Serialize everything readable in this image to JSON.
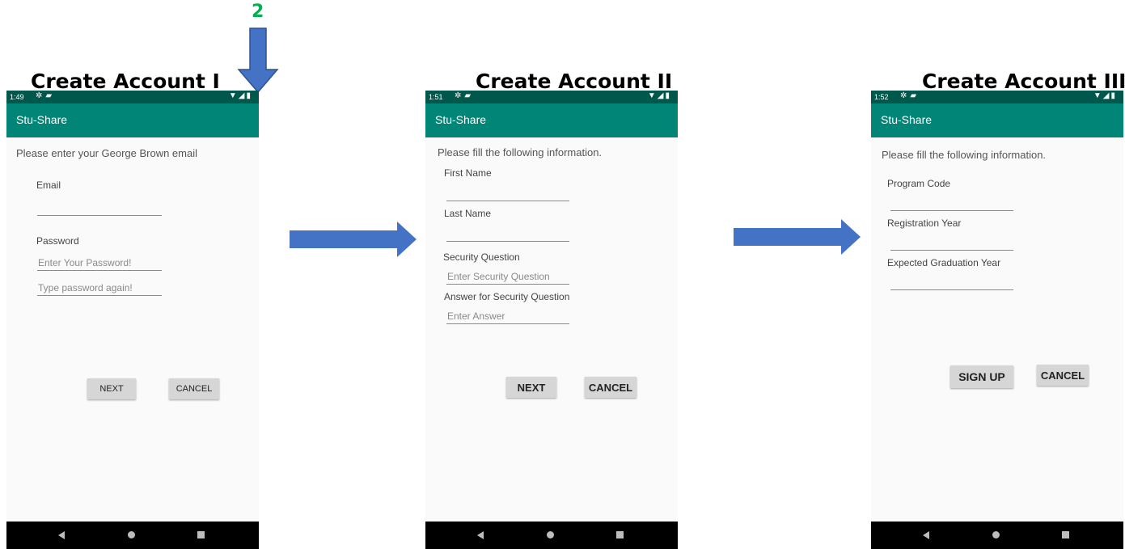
{
  "annotation": {
    "number": "2"
  },
  "screens": [
    {
      "heading": "Create Account I",
      "status_time": "1:49",
      "app_title": "Stu-Share",
      "instruction": "Please enter your George Brown email",
      "email_label": "Email",
      "email_value": "",
      "password_label": "Password",
      "password_placeholder": "Enter Your Password!",
      "confirm_placeholder": "Type password again!",
      "next_label": "NEXT",
      "cancel_label": "CANCEL"
    },
    {
      "heading": "Create Account II",
      "status_time": "1:51",
      "app_title": "Stu-Share",
      "instruction": "Please fill the following information.",
      "first_name_label": "First Name",
      "first_name_value": "",
      "last_name_label": "Last Name",
      "last_name_value": "",
      "security_question_label": "Security Question",
      "security_question_placeholder": "Enter Security Question",
      "answer_label": "Answer for Security Question",
      "answer_placeholder": "Enter Answer",
      "next_label": "NEXT",
      "cancel_label": "CANCEL"
    },
    {
      "heading": "Create Account III",
      "status_time": "1:52",
      "app_title": "Stu-Share",
      "instruction": "Please fill the following information.",
      "program_code_label": "Program Code",
      "program_code_value": "",
      "registration_year_label": "Registration Year",
      "registration_year_value": "",
      "graduation_year_label": "Expected Graduation Year",
      "graduation_year_value": "",
      "signup_label": "SIGN UP",
      "cancel_label": "CANCEL"
    }
  ],
  "colors": {
    "status_bar": "#00574b",
    "app_bar": "#008577",
    "arrow": "#4472c4",
    "annotation": "#00b050"
  },
  "icons": [
    "settings-icon",
    "sd-card-icon",
    "wifi-icon",
    "signal-icon",
    "battery-icon",
    "back-icon",
    "home-icon",
    "recents-icon",
    "flow-arrow-icon",
    "down-arrow-icon"
  ]
}
